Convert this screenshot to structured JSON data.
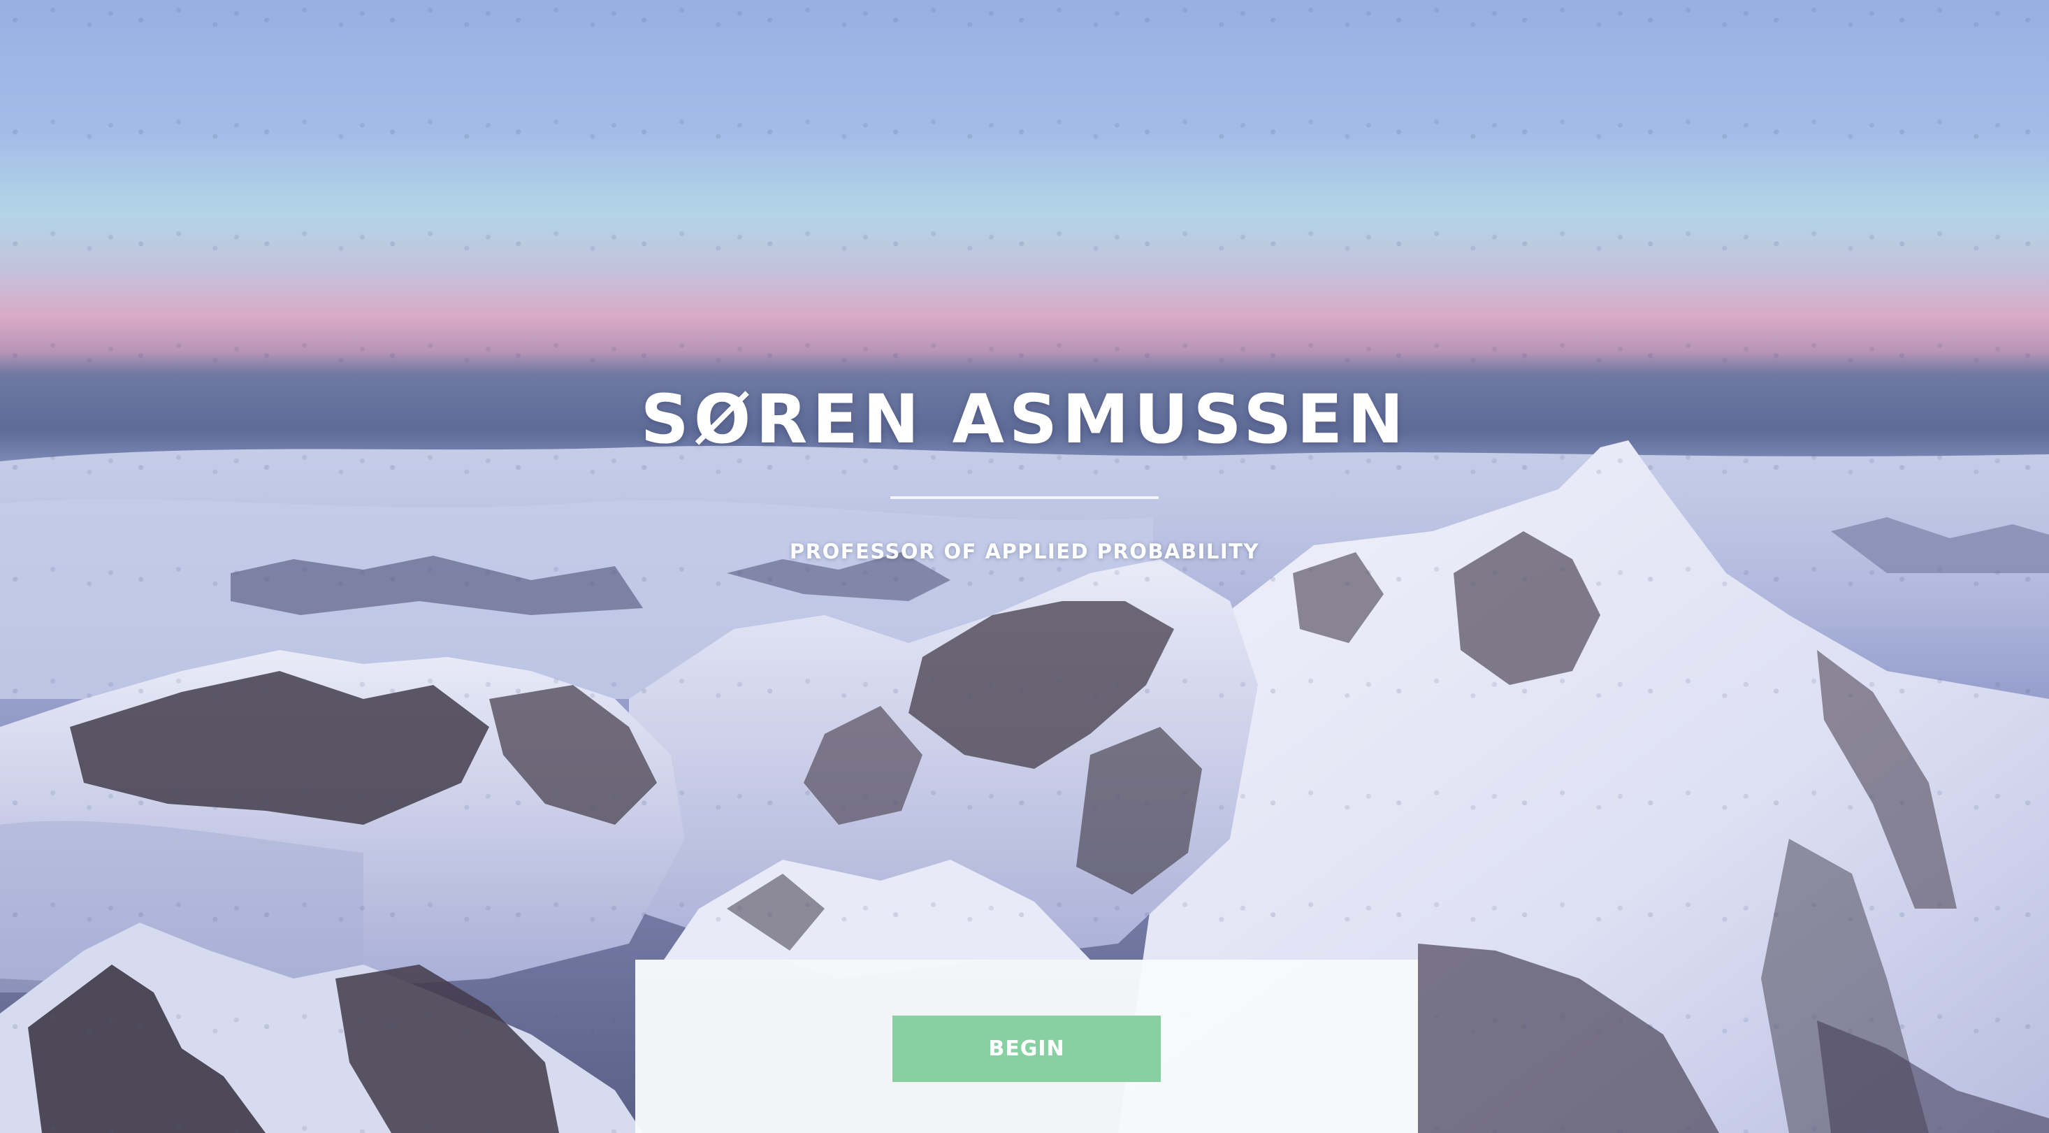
{
  "hero": {
    "name": "SØREN ASMUSSEN",
    "subtitle": "PROFESSOR OF APPLIED PROBABILITY",
    "background": "snow-capped-mountain-range-at-dawn-photo"
  },
  "cta": {
    "begin_label": "BEGIN"
  },
  "colors": {
    "accent": "#87d0a2",
    "text": "#ffffff",
    "panel": "#f8f9fa"
  }
}
